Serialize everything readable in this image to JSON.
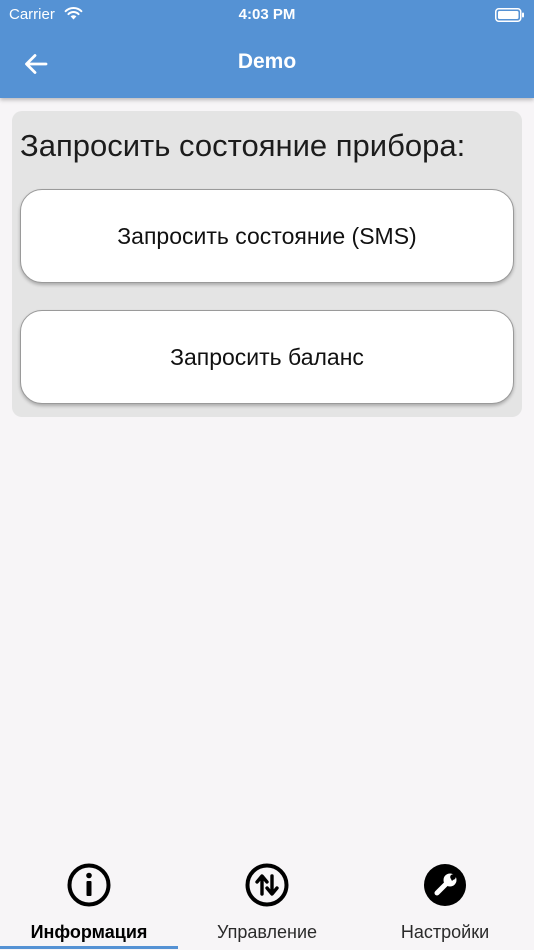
{
  "status_bar": {
    "carrier": "Carrier",
    "time": "4:03 PM"
  },
  "app_bar": {
    "title": "Demo",
    "back_icon": "arrow-left-icon"
  },
  "card": {
    "title": "Запросить состояние прибора:",
    "buttons": [
      {
        "label": "Запросить состояние (SMS)"
      },
      {
        "label": "Запросить баланс"
      }
    ]
  },
  "tabs": [
    {
      "label": "Информация",
      "icon": "info-icon",
      "active": true
    },
    {
      "label": "Управление",
      "icon": "swap-vertical-icon",
      "active": false
    },
    {
      "label": "Настройки",
      "icon": "wrench-icon",
      "active": false
    }
  ],
  "colors": {
    "primary": "#5592d4",
    "background": "#f7f5f7",
    "card": "#e4e4e4",
    "button": "#ffffff"
  }
}
